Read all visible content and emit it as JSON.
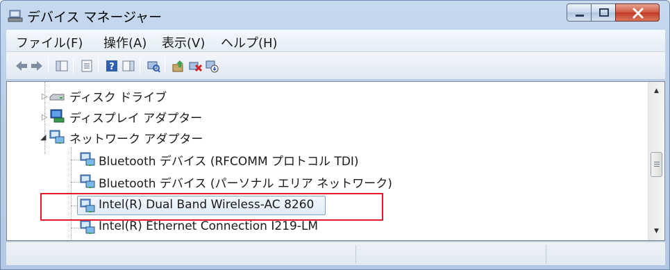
{
  "window": {
    "title": "デバイス マネージャー"
  },
  "menubar": {
    "items": [
      "ファイル(F)",
      "操作(A)",
      "表示(V)",
      "ヘルプ(H)"
    ]
  },
  "tree": {
    "rows": [
      {
        "label": "ディスク ドライブ",
        "icon": "disk-drive-icon",
        "expander": "collapsed"
      },
      {
        "label": "ディスプレイ アダプター",
        "icon": "display-adapter-icon",
        "expander": "collapsed"
      },
      {
        "label": "ネットワーク アダプター",
        "icon": "network-adapter-icon",
        "expander": "expanded"
      },
      {
        "label": "Bluetooth デバイス (RFCOMM プロトコル TDI)",
        "icon": "network-adapter-icon"
      },
      {
        "label": "Bluetooth デバイス (パーソナル エリア ネットワーク)",
        "icon": "network-adapter-icon"
      },
      {
        "label": "Intel(R) Dual Band Wireless-AC 8260",
        "icon": "network-adapter-icon",
        "selected": true
      },
      {
        "label": "Intel(R) Ethernet Connection I219-LM",
        "icon": "network-adapter-icon"
      }
    ]
  },
  "colors": {
    "highlight_border": "#e0192b",
    "close_button": "#c23a22",
    "selection": "#dfebf9"
  }
}
